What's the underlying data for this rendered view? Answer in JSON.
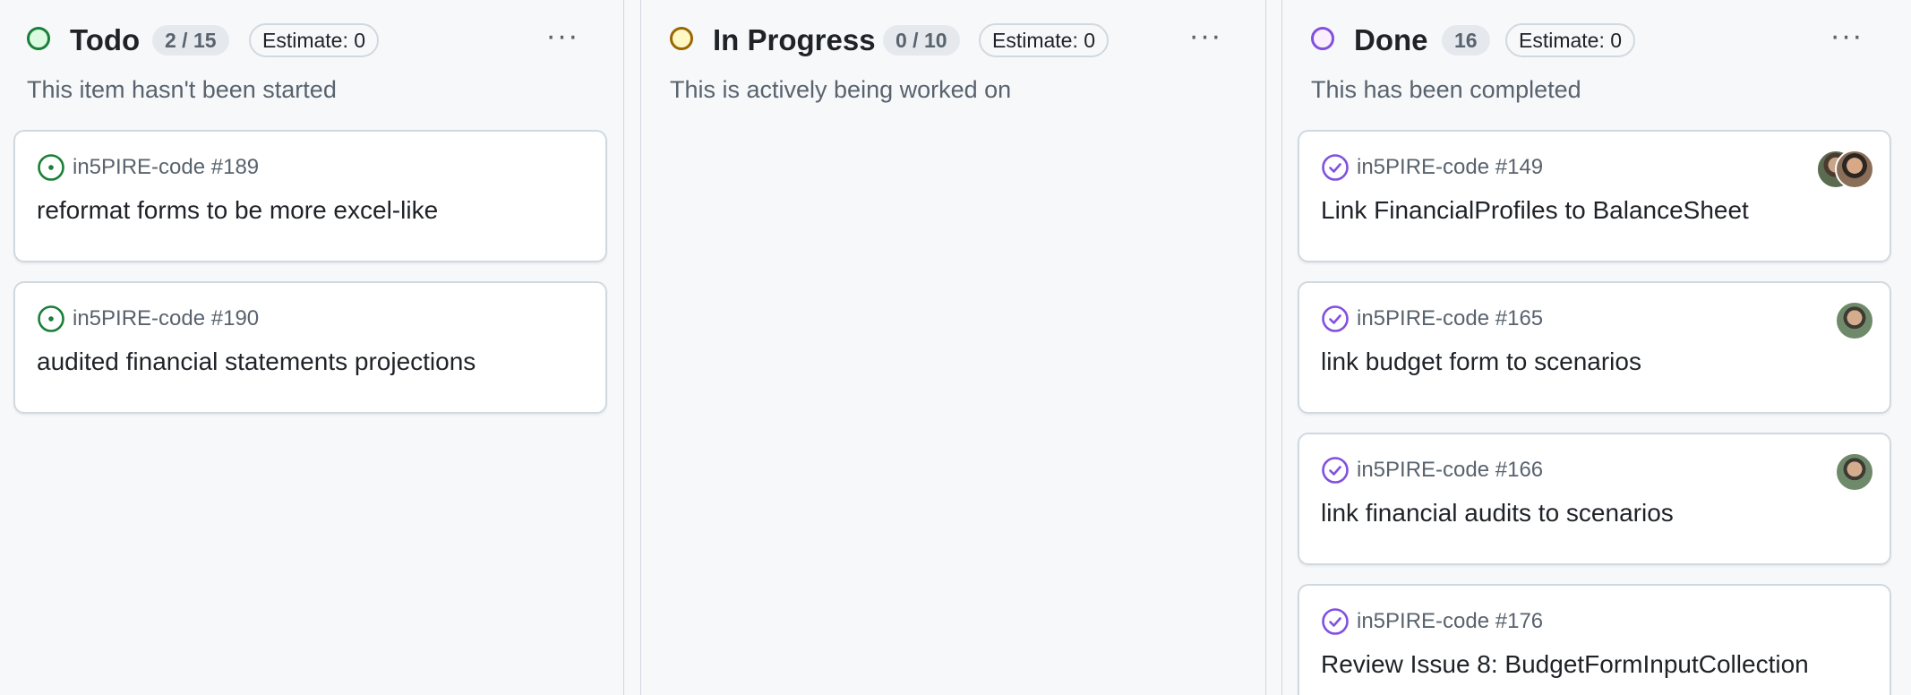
{
  "columns": [
    {
      "title": "Todo",
      "count": "2 / 15",
      "estimate": "Estimate: 0",
      "description": "This item hasn't been started",
      "status_color": "#1a7f37",
      "cards": [
        {
          "ref": "in5PIRE-code #189",
          "title": "reformat forms to be more excel-like",
          "state": "open"
        },
        {
          "ref": "in5PIRE-code #190",
          "title": "audited financial statements projections",
          "state": "open"
        }
      ]
    },
    {
      "title": "In Progress",
      "count": "0 / 10",
      "estimate": "Estimate: 0",
      "description": "This is actively being worked on",
      "status_color": "#9a6700",
      "cards": []
    },
    {
      "title": "Done",
      "count": "16",
      "estimate": "Estimate: 0",
      "description": "This has been completed",
      "status_color": "#8250df",
      "cards": [
        {
          "ref": "in5PIRE-code #149",
          "title": "Link FinancialProfiles to BalanceSheet",
          "state": "closed"
        },
        {
          "ref": "in5PIRE-code #165",
          "title": "link budget form to scenarios",
          "state": "closed"
        },
        {
          "ref": "in5PIRE-code #166",
          "title": "link financial audits to scenarios",
          "state": "closed"
        },
        {
          "ref": "in5PIRE-code #176",
          "title": "Review Issue 8: BudgetFormInputCollection",
          "state": "closed"
        }
      ]
    }
  ],
  "icons": {
    "open_issue": "issue-opened-icon",
    "closed_issue": "issue-closed-icon",
    "more": "kebab-horizontal-icon"
  },
  "more_glyph": "···"
}
